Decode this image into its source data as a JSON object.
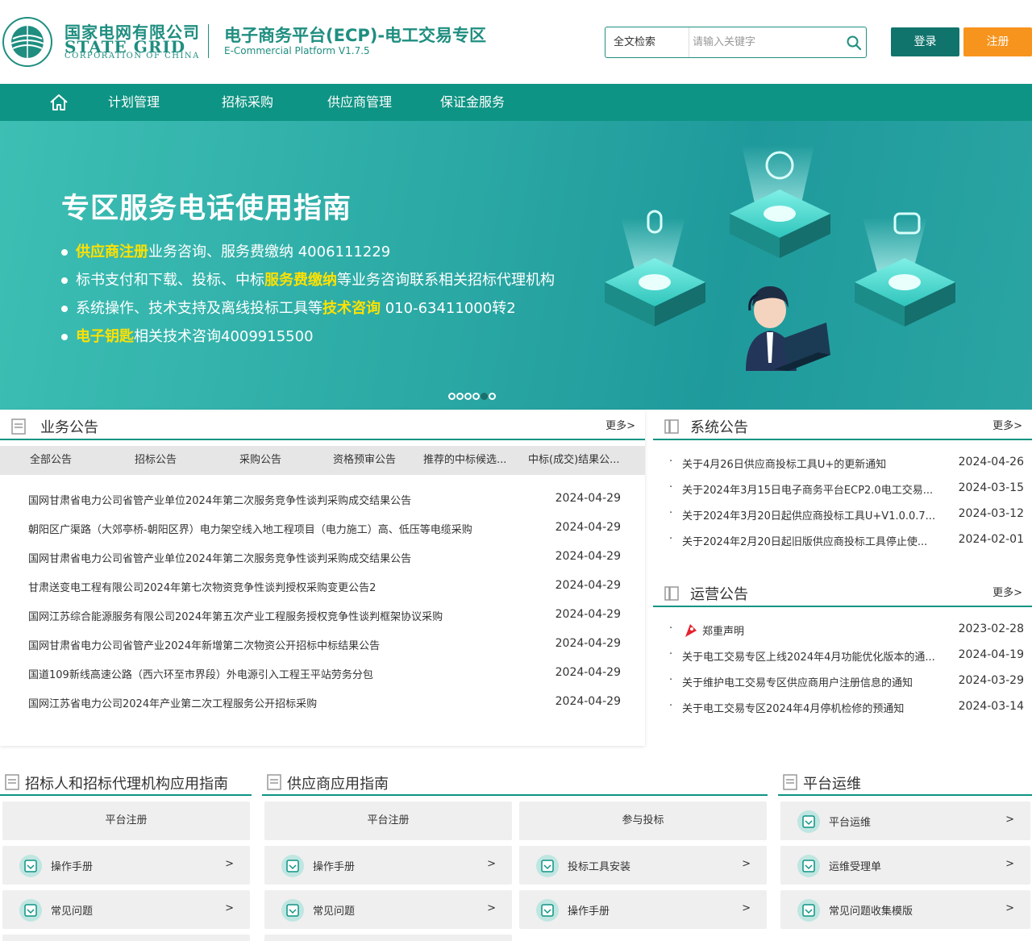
{
  "header": {
    "logo_cn": "国家电网有限公司",
    "logo_en1": "STATE GRID",
    "logo_en2": "CORPORATION OF CHINA",
    "site_title": "电子商务平台(ECP)-电工交易专区",
    "site_subtitle": "E-Commercial Platform V1.7.5",
    "search_scope": "全文检索",
    "search_placeholder": "请输入关键字",
    "login_label": "登录",
    "register_label": "注册"
  },
  "nav": {
    "items": [
      "计划管理",
      "招标采购",
      "供应商管理",
      "保证金服务"
    ]
  },
  "banner": {
    "title": "专区服务电话使用指南",
    "lines": [
      {
        "hl": "供应商注册",
        "rest": "业务咨询、服务费缴纳 4006111229"
      },
      {
        "pre": "标书支付和下载、投标、中标",
        "hl": "服务费缴纳",
        "rest": "等业务咨询联系相关招标代理机构"
      },
      {
        "pre": "系统操作、技术支持及离线投标工具等",
        "hl": "技术咨询",
        "rest": " 010-63411000转2"
      },
      {
        "hl": "电子钥匙",
        "rest": "相关技术咨询4009915500"
      }
    ],
    "slide_count": 6,
    "active_slide": 4
  },
  "business": {
    "title": "业务公告",
    "more": "更多>",
    "tabs": [
      "全部公告",
      "招标公告",
      "采购公告",
      "资格预审公告",
      "推荐的中标候选...",
      "中标(成交)结果公..."
    ],
    "rows": [
      {
        "title": "国网甘肃省电力公司省管产业单位2024年第二次服务竞争性谈判采购成交结果公告",
        "date": "2024-04-29"
      },
      {
        "title": "朝阳区广渠路（大郊亭桥-朝阳区界）电力架空线入地工程项目（电力施工）高、低压等电缆采购",
        "date": "2024-04-29"
      },
      {
        "title": "国网甘肃省电力公司省管产业单位2024年第二次服务竞争性谈判采购成交结果公告",
        "date": "2024-04-29"
      },
      {
        "title": "甘肃送变电工程有限公司2024年第七次物资竞争性谈判授权采购变更公告2",
        "date": "2024-04-29"
      },
      {
        "title": "国网江苏综合能源服务有限公司2024年第五次产业工程服务授权竞争性谈判框架协议采购",
        "date": "2024-04-29"
      },
      {
        "title": "国网甘肃省电力公司省管产业2024年新增第二次物资公开招标中标结果公告",
        "date": "2024-04-29"
      },
      {
        "title": "国道109新线高速公路（西六环至市界段）外电源引入工程王平站劳务分包",
        "date": "2024-04-29"
      },
      {
        "title": "国网江苏省电力公司2024年产业第二次工程服务公开招标采购",
        "date": "2024-04-29"
      }
    ]
  },
  "system": {
    "title": "系统公告",
    "more": "更多>",
    "rows": [
      {
        "title": "关于4月26日供应商投标工具U+的更新通知",
        "date": "2024-04-26"
      },
      {
        "title": "关于2024年3月15日电子商务平台ECP2.0电工交易...",
        "date": "2024-03-15"
      },
      {
        "title": "关于2024年3月20日起供应商投标工具U+V1.0.0.7...",
        "date": "2024-03-12"
      },
      {
        "title": "关于2024年2月20日起旧版供应商投标工具停止使...",
        "date": "2024-02-01"
      }
    ]
  },
  "operation": {
    "title": "运营公告",
    "more": "更多>",
    "rows": [
      {
        "title": "郑重声明",
        "date": "2023-02-28"
      },
      {
        "title": "关于电工交易专区上线2024年4月功能优化版本的通...",
        "date": "2024-04-19"
      },
      {
        "title": "关于维护电工交易专区供应商用户注册信息的通知",
        "date": "2024-03-29"
      },
      {
        "title": "关于电工交易专区2024年4月停机检修的预通知",
        "date": "2024-03-14"
      }
    ]
  },
  "guides": {
    "tenderer": {
      "title": "招标人和招标代理机构应用指南",
      "header": "平台注册",
      "items": [
        "操作手册",
        "常见问题"
      ]
    },
    "supplier": {
      "title": "供应商应用指南",
      "col1_header": "平台注册",
      "col1_items": [
        "操作手册",
        "常见问题"
      ],
      "col2_header": "参与投标",
      "col2_items": [
        "投标工具安装",
        "操作手册"
      ]
    },
    "ops": {
      "title": "平台运维",
      "items": [
        "平台运维",
        "运维受理单",
        "常见问题收集模版"
      ]
    },
    "arrow": ">"
  },
  "colors": {
    "brand": "#0e9484",
    "dark_teal": "#11746c",
    "orange": "#f7941d",
    "highlight": "#ffe100"
  }
}
